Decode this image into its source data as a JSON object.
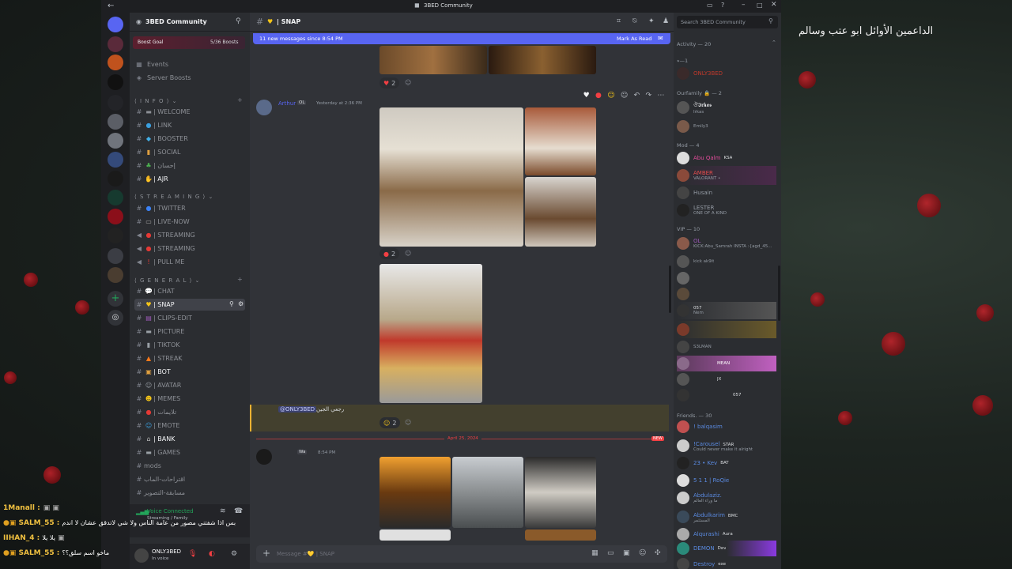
{
  "window_title": "3BED Community",
  "overlay_top_right": "الداعمين الأوائل ابو عتب وسالم",
  "server": {
    "name": "3BED Community",
    "boost_goal_label": "Boost Goal",
    "boost_count": "5/36 Boosts"
  },
  "sidebar_links": [
    "Events",
    "Server Boosts"
  ],
  "categories": {
    "info": "⟨ I N F O ⟩ ⌄",
    "streaming": "⟨ S T R E A M I N G ⟩ ⌄",
    "general": "⟨ G E N E R A L ⟩ ⌄"
  },
  "info_channels": [
    "| WELCOME",
    "| LINK",
    "| BOOSTER",
    "| SOCIAL",
    "| إحسان",
    "| AJR"
  ],
  "streaming_channels": [
    "| TWITTER",
    "| LIVE-NOW",
    "| STREAMING",
    "| STREAMING",
    "| PULL ME"
  ],
  "general_channels": [
    "| CHAT",
    "| SNAP",
    "| CLIPS-EDIT",
    "| PICTURE",
    "| TIKTOK",
    "| STREAK",
    "| BOT",
    "| AVATAR",
    "| MEMES",
    "| تلايمات",
    "| EMOTE",
    "| BANK",
    "| GAMES",
    "mods",
    "اقتراحات-الماب",
    "مسابقة-التصوير"
  ],
  "voice": {
    "status": "Voice Connected",
    "sub": "Streaming / Family"
  },
  "user": {
    "name": "ONLY3BED",
    "status": "In voice"
  },
  "chat_header": {
    "channel": "| SNAP"
  },
  "new_messages_bar": {
    "text": "11 new messages since 8:54 PM",
    "action": "Mark As Read"
  },
  "messages": {
    "arthur_name": "Arthur",
    "arthur_tag": "OL",
    "arthur_time": "Yesterday at 2:36 PM",
    "reply_mention": "@ONLY3BED",
    "reply_text": "رجعي الجين",
    "react_counts": [
      "2",
      "2",
      "2"
    ],
    "date_divider": "April 25, 2024",
    "new_label": "NEW",
    "wa_tag": "Wa",
    "wa_time": "8:54 PM"
  },
  "composer_placeholder": "Message #💛 | SNAP",
  "search_placeholder": "Search 3BED Community",
  "members": {
    "activity": "Activity — 20",
    "groups": [
      {
        "label": "⭑—1"
      },
      {
        "label": "Ourfamily 🔒 — 2"
      },
      {
        "label": "Mod — 4"
      },
      {
        "label": "VIP — 10"
      },
      {
        "label": "Friends. — 30"
      }
    ],
    "names": {
      "m0": "ONLY3BED",
      "m1": "ঔ𝕴𝖗𝖐𝖆𝖘",
      "m1s": "Irkas",
      "m2": "Emily3",
      "m3": "Abu Qalm",
      "m3b": "KSA",
      "m4": "AMBER",
      "m4s": "VALORANT •",
      "m5": "Husain",
      "m6": "LESTER",
      "m6s": "ONE OF A KIND",
      "m7b": "OL",
      "m7s": "KICK:Abu_Samrah INSTA :{agd_45...",
      "m8s": "kick ak9it",
      "m9b": "057",
      "m9s": "Nem",
      "m10s": "S3LMAN",
      "m11b": "MEAN",
      "m12b": "JX",
      "m13b": "057",
      "f1": "! balqasim",
      "f2": "!Carousel",
      "f2b": "STAR",
      "f2s": "Could never make it alright",
      "f3": "23 • Kev",
      "f3b": "BAT",
      "f4": "5 1 1 | RoQie",
      "f5": "Abdulaziz.",
      "f5s": "ما وراء العالم",
      "f6": "Abdulkarim",
      "f6b": "BMC",
      "f6s": "المستثمر",
      "f7": "Alqurashi",
      "f7b": "Aura",
      "f8": "DEMON",
      "f8b": "Dev",
      "f9": "Destroy",
      "f9b": "exe"
    }
  },
  "stream_chat": [
    {
      "user": "1Manall :",
      "text": ""
    },
    {
      "user": "SALM_55 :",
      "text": "بس اذا شفتني مصور من عامة الناس ولا شي لاتدقق عشان لا اندم"
    },
    {
      "user": "IIHAN_4 :",
      "text": "يلا يلا"
    },
    {
      "user": "SALM_55 :",
      "text": "ماخو اسم سلق؟؟"
    }
  ],
  "colors": {
    "accent": "#5865f2",
    "bg_main": "#313338",
    "bg_side": "#2b2d31",
    "bg_servers": "#1e1f22",
    "mention_bg": "#43402e",
    "new_red": "#f23f43"
  }
}
